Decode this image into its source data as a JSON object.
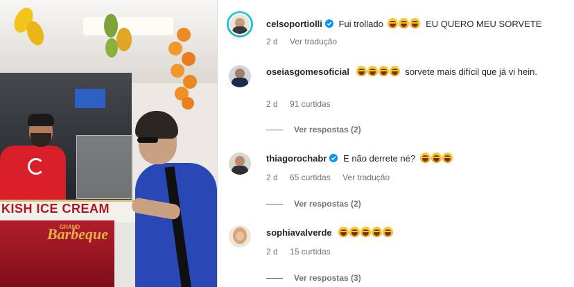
{
  "video": {
    "counter_sign": "KISH ICE CREAM",
    "logo_top": "GRAND",
    "logo_main": "Barbeque"
  },
  "comments": [
    {
      "username": "celsoportiolli",
      "verified": true,
      "text_before": "Fui trollado",
      "emoji_count": 3,
      "text_after": "EU QUERO MEU SORVETE",
      "age": "2 d",
      "action": "Ver tradução"
    },
    {
      "username": "oseiasgomesoficial",
      "verified": false,
      "text_before": "",
      "emoji_count": 4,
      "text_after": "sorvete mais difícil que já vi hein.",
      "age": "2 d",
      "likes": "91 curtidas",
      "replies": "Ver respostas (2)"
    },
    {
      "username": "thiagorochabr",
      "verified": true,
      "text_before": "E não derrete né?",
      "emoji_count": 3,
      "text_after": "",
      "age": "2 d",
      "likes": "65 curtidas",
      "action": "Ver tradução",
      "replies": "Ver respostas (2)"
    },
    {
      "username": "sophiavalverde",
      "verified": false,
      "text_before": "",
      "emoji_count": 5,
      "text_after": "",
      "age": "2 d",
      "likes": "15 curtidas",
      "replies": "Ver respostas (3)"
    }
  ],
  "colors": {
    "verified": "#0095f6",
    "meta": "#737373",
    "text": "#262626"
  }
}
